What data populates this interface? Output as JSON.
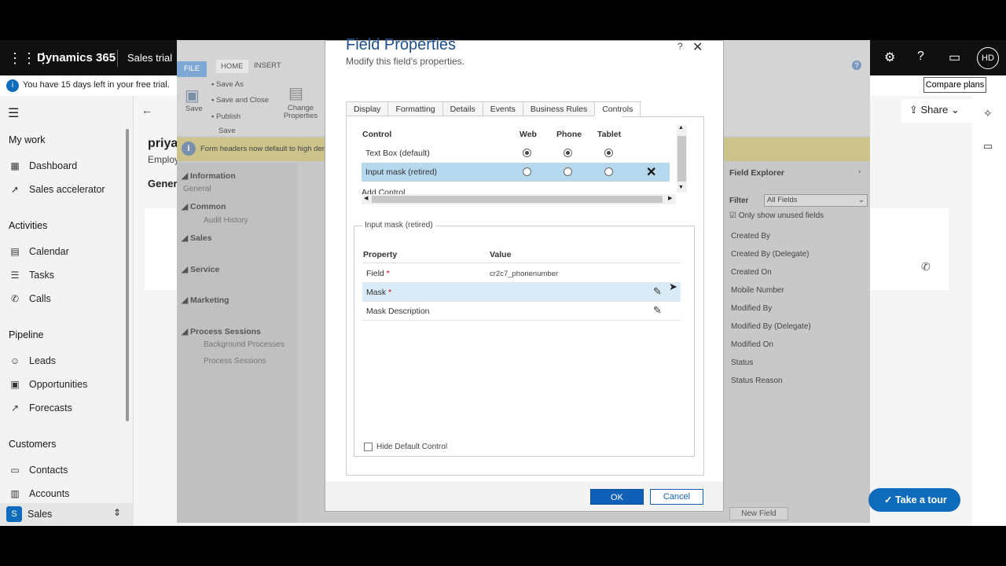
{
  "topbar": {
    "app_name": "Dynamics 365",
    "area_name": "Sales trial",
    "avatar_initials": "HD"
  },
  "trial": {
    "message": "You have 15 days left in your free trial.",
    "compare_label": "Compare plans"
  },
  "leftnav": {
    "my_work": "My work",
    "dashboard": "Dashboard",
    "sales_accelerator": "Sales accelerator",
    "activities": "Activities",
    "calendar": "Calendar",
    "tasks": "Tasks",
    "calls": "Calls",
    "pipeline": "Pipeline",
    "leads": "Leads",
    "opportunities": "Opportunities",
    "forecasts": "Forecasts",
    "customers": "Customers",
    "contacts": "Contacts",
    "accounts": "Accounts",
    "area_badge": "S",
    "area_label": "Sales"
  },
  "record": {
    "title": "priya",
    "subtitle": "Employ",
    "tab": "Genera",
    "share": "Share",
    "take_tour": "Take a tour"
  },
  "editor": {
    "tab_file": "FILE",
    "tab_home": "HOME",
    "tab_insert": "INSERT",
    "save": "Save",
    "save_as": "Save As",
    "save_and_close": "Save and Close",
    "publish": "Publish",
    "save_group": "Save",
    "change_properties": "Change Properties",
    "banner": "Form headers now default to high der",
    "nav": {
      "information": "Information",
      "general": "General",
      "common": "Common",
      "audit_history": "Audit History",
      "sales": "Sales",
      "service": "Service",
      "marketing": "Marketing",
      "process_sessions": "Process Sessions",
      "background_processes": "Background Processes",
      "process_sessions_item": "Process Sessions"
    },
    "explorer": {
      "title": "Field Explorer",
      "filter_label": "Filter",
      "filter_value": "All Fields",
      "only_unused": "Only show unused fields",
      "fields": [
        "Created By",
        "Created By (Delegate)",
        "Created On",
        "Mobile Number",
        "Modified By",
        "Modified By (Delegate)",
        "Modified On",
        "Status",
        "Status Reason"
      ],
      "new_field": "New Field"
    }
  },
  "dialog": {
    "title": "Field Properties",
    "subtitle": "Modify this field's properties.",
    "help": "?",
    "tabs": [
      "Display",
      "Formatting",
      "Details",
      "Events",
      "Business Rules",
      "Controls"
    ],
    "controls": {
      "headers": {
        "control": "Control",
        "web": "Web",
        "phone": "Phone",
        "tablet": "Tablet"
      },
      "rows": [
        {
          "name": "Text Box (default)"
        },
        {
          "name": "Input mask (retired)"
        }
      ],
      "add_control": "Add Control..."
    },
    "group": {
      "legend": "Input mask (retired)",
      "prop_header": "Property",
      "value_header": "Value",
      "field_label": "Field",
      "field_value": "cr2c7_phonenumber",
      "mask_label": "Mask",
      "mask_desc_label": "Mask Description",
      "required_mark": "*",
      "hide_default": "Hide Default Control"
    },
    "ok": "OK",
    "cancel": "Cancel"
  }
}
